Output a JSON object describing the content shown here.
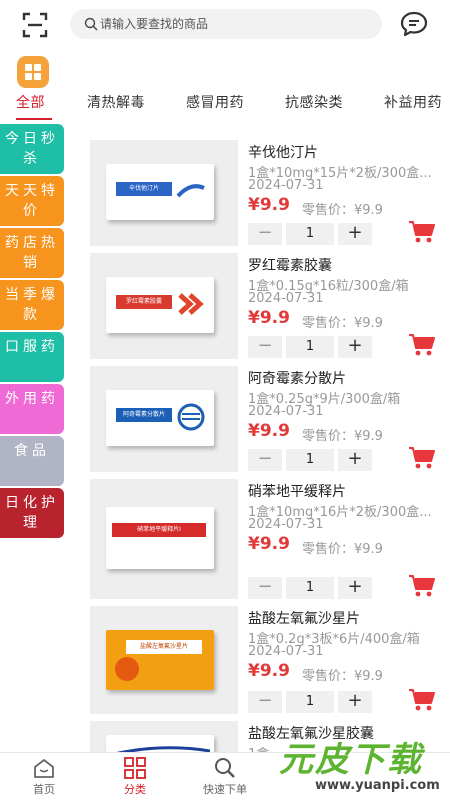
{
  "search": {
    "placeholder": "请输入要查找的商品"
  },
  "tabs": [
    {
      "label": "全部",
      "active": true
    },
    {
      "label": "清热解毒"
    },
    {
      "label": "感冒用药"
    },
    {
      "label": "抗感染类"
    },
    {
      "label": "补益用药"
    }
  ],
  "sidemenu": [
    {
      "label": "今日秒杀",
      "color": "#1fbfa7"
    },
    {
      "label": "天天特价",
      "color": "#f7941d"
    },
    {
      "label": "药店热销",
      "color": "#f7941d"
    },
    {
      "label": "当季爆款",
      "color": "#f7941d"
    },
    {
      "label": "口服药",
      "color": "#1fbfa7"
    },
    {
      "label": "外用药",
      "color": "#f06ad6"
    },
    {
      "label": "食品",
      "color": "#b0b4c4"
    },
    {
      "label": "日化护理",
      "color": "#b8232e"
    }
  ],
  "products": [
    {
      "name": "辛伐他汀片",
      "spec": "1盒*10mg*15片*2板/300盒...",
      "date": "2024-07-31",
      "price": "¥9.9",
      "retail": "零售价：¥9.9",
      "qty": "1",
      "box_label": "辛伐他汀片",
      "box_color": "#2a64c5"
    },
    {
      "name": "罗红霉素胶囊",
      "spec": "1盒*0.15g*16粒/300盒/箱",
      "date": "2024-07-31",
      "price": "¥9.9",
      "retail": "零售价：¥9.9",
      "qty": "1",
      "box_label": "罗红霉素胶囊",
      "box_color": "#d93a2e"
    },
    {
      "name": "阿奇霉素分散片",
      "spec": "1盒*0.25g*9片/300盒/箱",
      "date": "2024-07-31",
      "price": "¥9.9",
      "retail": "零售价：¥9.9",
      "qty": "1",
      "box_label": "阿奇霉素分散片",
      "box_color": "#1c5fb6"
    },
    {
      "name": "硝苯地平缓释片",
      "spec": "1盒*10mg*16片*2板/300盒...",
      "date": "2024-07-31",
      "price": "¥9.9",
      "retail": "零售价：¥9.9",
      "qty": "1",
      "box_label": "硝苯地平缓释片Ⅰ",
      "box_color": "#d62b2b"
    },
    {
      "name": "盐酸左氧氟沙星片",
      "spec": "1盒*0.2g*3板*6片/400盒/箱",
      "date": "2024-07-31",
      "price": "¥9.9",
      "retail": "零售价：¥9.9",
      "qty": "1",
      "box_label": "盐酸左氧氟沙星片",
      "box_color": "#f2a012"
    },
    {
      "name": "盐酸左氧氟沙星胶囊",
      "spec": "1盒",
      "date": "",
      "price": "",
      "retail": "",
      "qty": "",
      "box_label": "",
      "box_color": "#1c3f9a"
    }
  ],
  "bottomnav": [
    {
      "label": "首页",
      "icon": "home-icon"
    },
    {
      "label": "分类",
      "icon": "category-icon",
      "active": true
    },
    {
      "label": "快速下单",
      "icon": "search-icon"
    }
  ],
  "watermark": {
    "brand": "元皮下载",
    "url": "www.yuanpi.com"
  },
  "colors": {
    "accent": "#d4202a",
    "price": "#e23a3a",
    "cart": "#e8373a",
    "grid_button": "#f6a23a"
  }
}
